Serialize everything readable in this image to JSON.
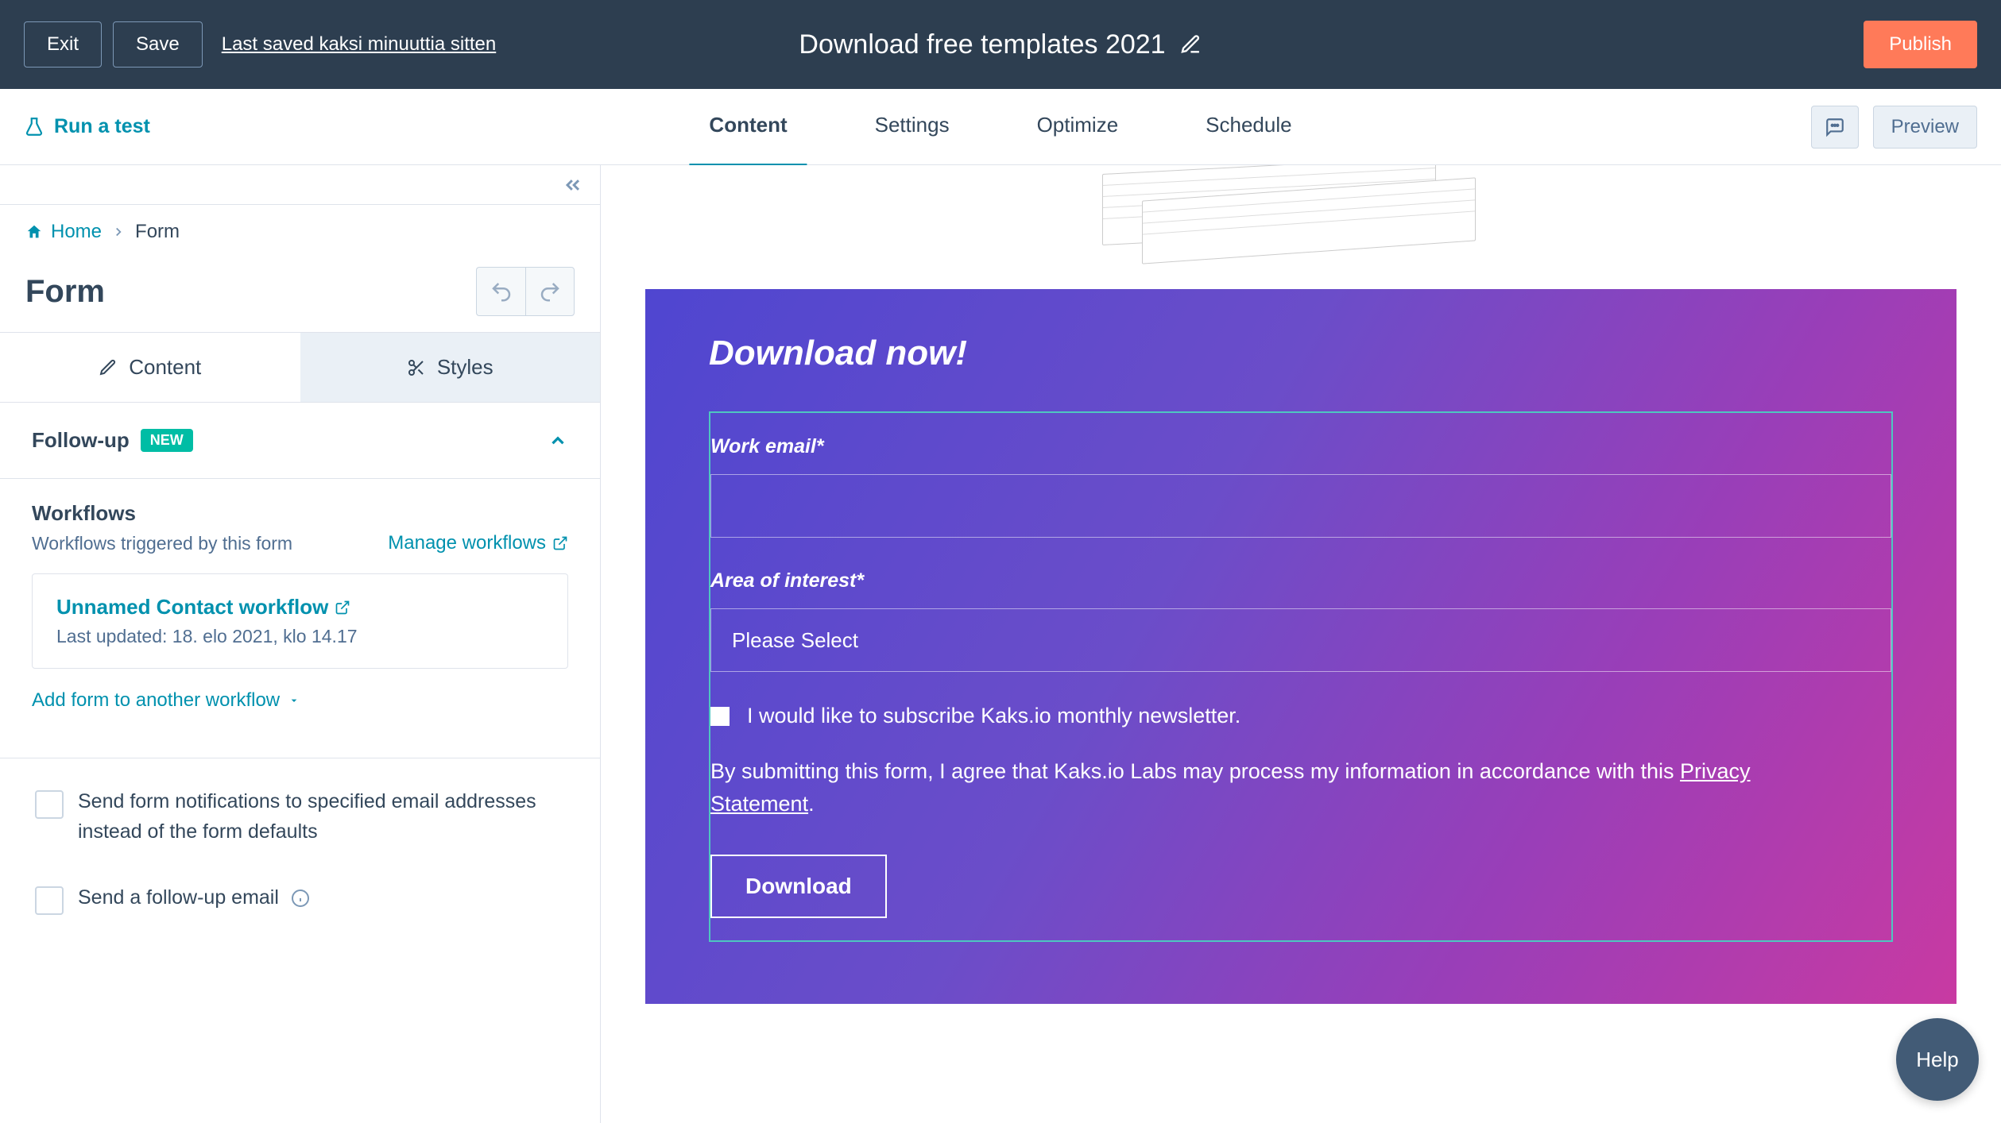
{
  "header": {
    "exit": "Exit",
    "save": "Save",
    "last_saved": "Last saved kaksi minuuttia sitten",
    "title": "Download free templates 2021",
    "publish": "Publish"
  },
  "subnav": {
    "run_test": "Run a test",
    "tabs": [
      "Content",
      "Settings",
      "Optimize",
      "Schedule"
    ],
    "active_tab": "Content",
    "preview": "Preview"
  },
  "sidebar": {
    "breadcrumb": {
      "home": "Home",
      "current": "Form"
    },
    "panel_title": "Form",
    "inner_tabs": {
      "content": "Content",
      "styles": "Styles",
      "active": "Content"
    },
    "section": {
      "title": "Follow-up",
      "badge": "NEW"
    },
    "workflows": {
      "heading": "Workflows",
      "sub": "Workflows triggered by this form",
      "manage": "Manage workflows",
      "card": {
        "name": "Unnamed Contact workflow",
        "updated": "Last updated: 18. elo 2021, klo 14.17"
      },
      "add": "Add form to another workflow"
    },
    "checkboxes": {
      "notifications": "Send form notifications to specified email addresses instead of the form defaults",
      "followup": "Send a follow-up email"
    }
  },
  "preview": {
    "heading": "Download now!",
    "fields": {
      "email_label": "Work email*",
      "interest_label": "Area of interest*",
      "interest_placeholder": "Please Select",
      "consent": "I would like to subscribe Kaks.io monthly newsletter.",
      "disclaimer_prefix": "By submitting this form, I agree that Kaks.io Labs may process my information in accordance with this ",
      "disclaimer_link": "Privacy Statement",
      "disclaimer_suffix": ".",
      "submit": "Download"
    }
  },
  "help": "Help"
}
